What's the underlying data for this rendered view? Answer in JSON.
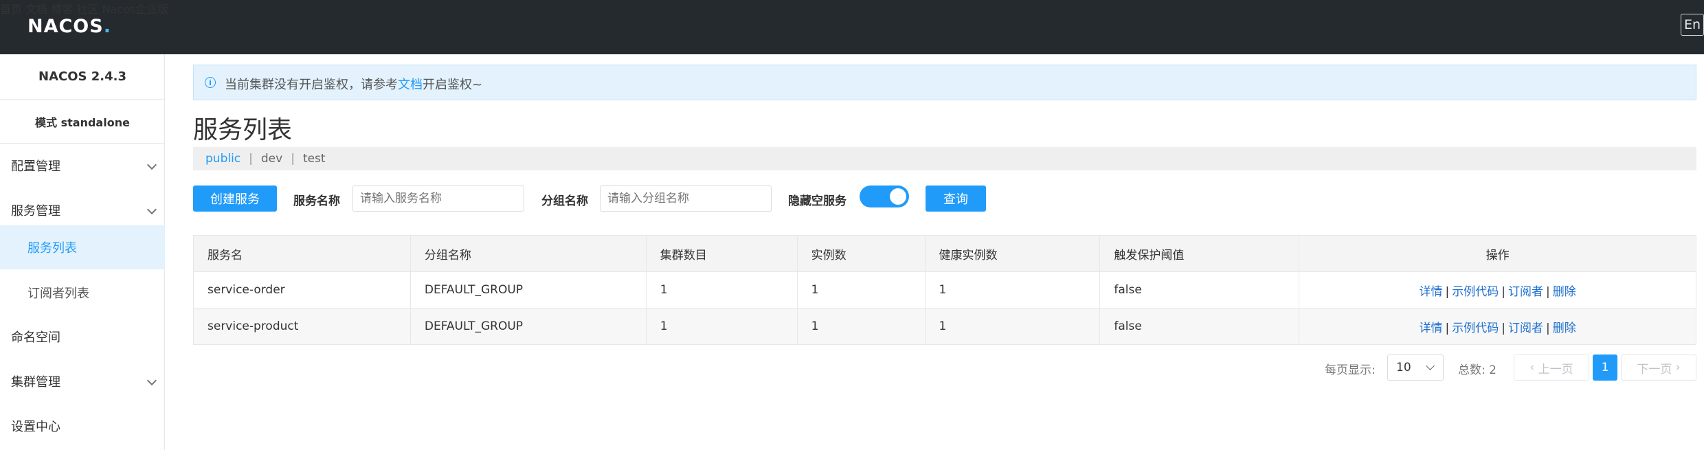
{
  "header": {
    "logo_main": "NACOS",
    "logo_dot": ".",
    "nav": [
      "首页",
      "文档",
      "博客",
      "社区",
      "Nacos企业版"
    ],
    "lang_button": "En"
  },
  "sidebar": {
    "version": "NACOS 2.4.3",
    "mode": "模式 standalone",
    "items": [
      {
        "label": "配置管理",
        "has_chevron": true
      },
      {
        "label": "服务管理",
        "has_chevron": true
      },
      {
        "label": "服务列表",
        "sub": true,
        "active": true
      },
      {
        "label": "订阅者列表",
        "sub": true
      },
      {
        "label": "命名空间"
      },
      {
        "label": "集群管理",
        "has_chevron": true
      },
      {
        "label": "设置中心"
      }
    ]
  },
  "notice": {
    "icon": "info-icon",
    "text_before": "当前集群没有开启鉴权，请参考",
    "link": "文档",
    "text_after": "开启鉴权~"
  },
  "page_title": "服务列表",
  "namespaces": {
    "items": [
      "public",
      "dev",
      "test"
    ],
    "active": "public"
  },
  "toolbar": {
    "create_button": "创建服务",
    "service_name_label": "服务名称",
    "service_name_placeholder": "请输入服务名称",
    "group_name_label": "分组名称",
    "group_name_placeholder": "请输入分组名称",
    "hide_empty_label": "隐藏空服务",
    "hide_empty_enabled": true,
    "query_button": "查询"
  },
  "table": {
    "columns": [
      "服务名",
      "分组名称",
      "集群数目",
      "实例数",
      "健康实例数",
      "触发保护阈值",
      "操作"
    ],
    "rows": [
      {
        "service": "service-order",
        "group": "DEFAULT_GROUP",
        "clusters": "1",
        "instances": "1",
        "healthy": "1",
        "protect": "false"
      },
      {
        "service": "service-product",
        "group": "DEFAULT_GROUP",
        "clusters": "1",
        "instances": "1",
        "healthy": "1",
        "protect": "false"
      }
    ],
    "actions": [
      "详情",
      "示例代码",
      "订阅者",
      "删除"
    ]
  },
  "pagination": {
    "page_size_label": "每页显示:",
    "page_size": "10",
    "total_label": "总数:",
    "total": "2",
    "prev": "上一页",
    "next": "下一页",
    "current_page": "1"
  },
  "colors": {
    "topbar": "#252a2f",
    "accent": "#209bfa",
    "link": "#1e6fce",
    "notice_bg": "#e3f2fd"
  }
}
